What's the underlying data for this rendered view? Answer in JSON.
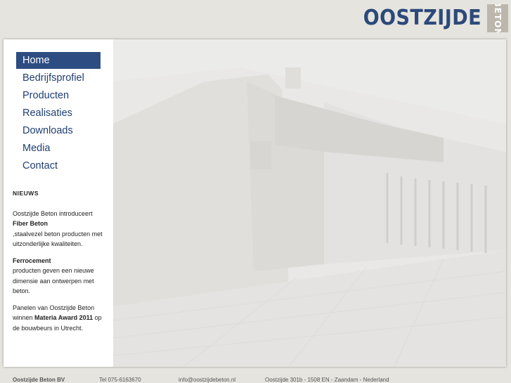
{
  "logo": {
    "word": "OOSTZIJDE",
    "box_text": "BETON"
  },
  "nav": {
    "items": [
      {
        "label": "Home"
      },
      {
        "label": "Bedrijfsprofiel"
      },
      {
        "label": "Producten"
      },
      {
        "label": "Realisaties"
      },
      {
        "label": "Downloads"
      },
      {
        "label": "Media"
      },
      {
        "label": "Contact"
      }
    ]
  },
  "news": {
    "heading": "NIEUWS",
    "item1": {
      "text1": "Oostzijde Beton introduceert",
      "bold": "Fiber Beton",
      "text2": ",staalvezel beton producten met uitzonderlijke kwaliteiten."
    },
    "item2": {
      "bold": "Ferrocement",
      "text": "producten geven een nieuwe dimensie aan ontwerpen met beton."
    },
    "item3": {
      "text1": "Panelen van Oostzijde Beton winnen",
      "bold": "Materia Award 2011",
      "text2": "op de bouwbeurs in Utrecht."
    }
  },
  "footer": {
    "company": "Oostzijde Beton BV",
    "phone": "Tel 075-6163670",
    "email": "info@oostzijdebeton.nl",
    "address": "Oostzijde 301b - 1508 EN - Zaandam - Nederland"
  },
  "colors": {
    "brand": "#2b4a7a",
    "nav_active_bg": "#2d4d82",
    "logo_box": "#bdb6ac",
    "page_bg": "#e6e4de"
  }
}
